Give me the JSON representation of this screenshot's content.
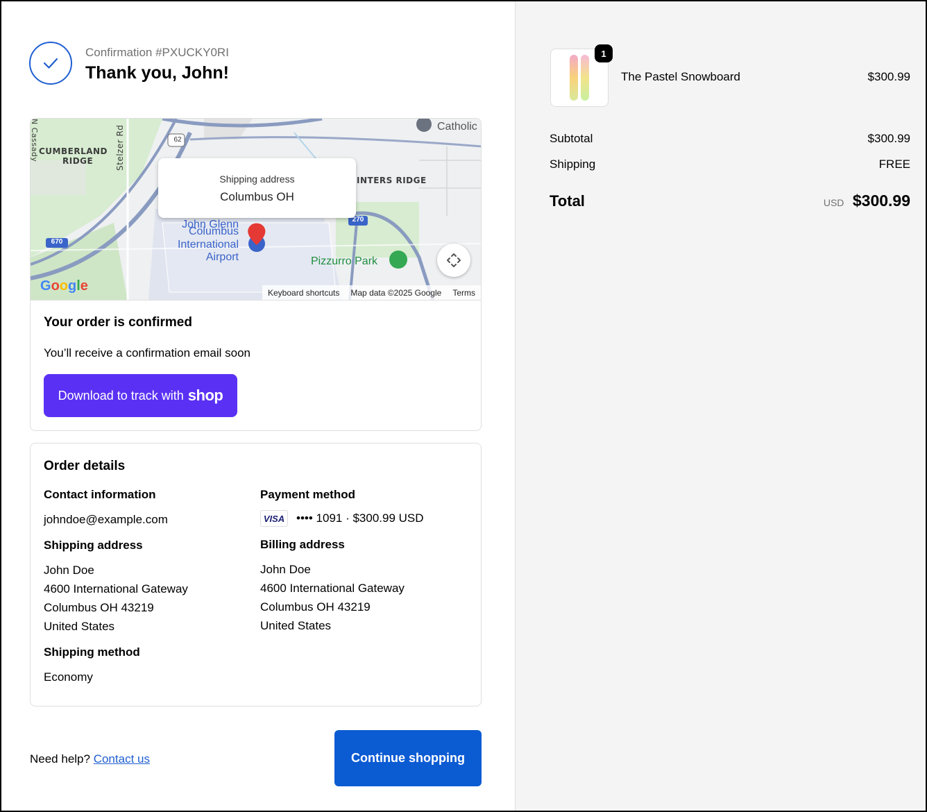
{
  "header": {
    "confirmation_number": "Confirmation #PXUCKY0RI",
    "thank_you": "Thank you, John!"
  },
  "map": {
    "popup_label": "Shipping address",
    "popup_city": "Columbus OH",
    "labels": {
      "cumberland": "CUMBERLAND",
      "ridge": "RIDGE",
      "stelzer": "Stelzer Rd",
      "cassady": "N Cassady",
      "inters_ridge": "INTERS RIDGE",
      "catholic": "Catholic",
      "john_glenn": "John Glenn",
      "columbus": "Columbus",
      "international": "International",
      "airport": "Airport",
      "pizzurro": "Pizzurro Park",
      "route_62": "62",
      "route_670": "670",
      "route_270": "270"
    },
    "google_logo": "Google",
    "footer": {
      "shortcuts": "Keyboard shortcuts",
      "map_data": "Map data ©2025 Google",
      "terms": "Terms"
    }
  },
  "order_status": {
    "title": "Your order is confirmed",
    "subtitle": "You’ll receive a confirmation email soon",
    "shop_button_prefix": "Download to track with",
    "shop_button_brand": "shop"
  },
  "order_details": {
    "title": "Order details",
    "contact": {
      "heading": "Contact information",
      "email": "johndoe@example.com"
    },
    "payment": {
      "heading": "Payment method",
      "card_brand": "VISA",
      "summary": "•••• 1091 · $300.99 USD"
    },
    "shipping_address": {
      "heading": "Shipping address",
      "lines": [
        "John Doe",
        "4600 International Gateway",
        "Columbus OH 43219",
        "United States"
      ]
    },
    "billing_address": {
      "heading": "Billing address",
      "lines": [
        "John Doe",
        "4600 International Gateway",
        "Columbus OH 43219",
        "United States"
      ]
    },
    "shipping_method": {
      "heading": "Shipping method",
      "value": "Economy"
    }
  },
  "footer": {
    "help_text": "Need help?",
    "contact_link": "Contact us",
    "continue_button": "Continue shopping"
  },
  "summary": {
    "product": {
      "name": "The Pastel Snowboard",
      "price": "$300.99",
      "quantity": "1"
    },
    "subtotal_label": "Subtotal",
    "subtotal_value": "$300.99",
    "shipping_label": "Shipping",
    "shipping_value": "FREE",
    "total_label": "Total",
    "total_currency": "USD",
    "total_value": "$300.99"
  },
  "colors": {
    "accent": "#0b5bd3",
    "shop_purple": "#5a31f4",
    "check_blue": "#1f5fd1",
    "summary_bg": "#f4f4f4"
  }
}
